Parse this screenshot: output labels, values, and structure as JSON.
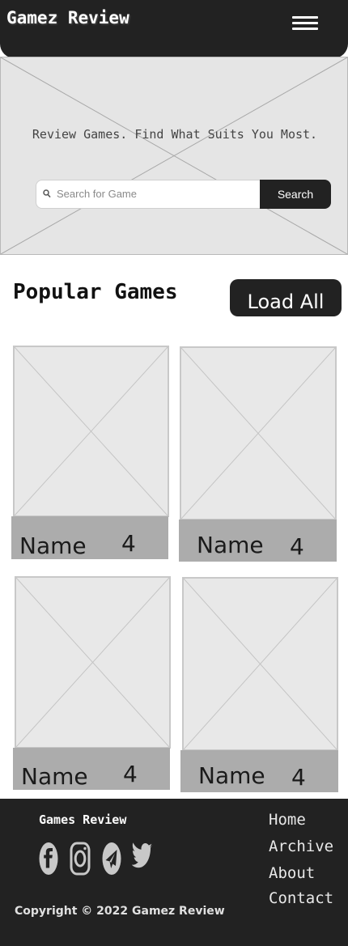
{
  "header": {
    "title": "Gamez Review",
    "menu_icon": "hamburger-menu-icon"
  },
  "hero": {
    "tagline": "Review Games. Find What Suits You Most.",
    "search": {
      "placeholder": "Search for Game",
      "button_label": "Search"
    }
  },
  "popular": {
    "title": "Popular Games",
    "load_all_label": "Load All",
    "games": [
      {
        "name": "Name",
        "rating": "4"
      },
      {
        "name": "Name",
        "rating": "4"
      },
      {
        "name": "Name",
        "rating": "4"
      },
      {
        "name": "Name",
        "rating": "4"
      }
    ]
  },
  "footer": {
    "brand": "Games Review",
    "social": [
      "facebook-icon",
      "instagram-icon",
      "telegram-icon",
      "twitter-icon"
    ],
    "links": [
      "Home",
      "Archive",
      "About",
      "Contact"
    ],
    "copyright": "Copyright © 2022 Gamez Review"
  },
  "colors": {
    "dark": "#222222",
    "placeholder_bg": "#e5e5e5",
    "card_bar": "#acacac"
  }
}
